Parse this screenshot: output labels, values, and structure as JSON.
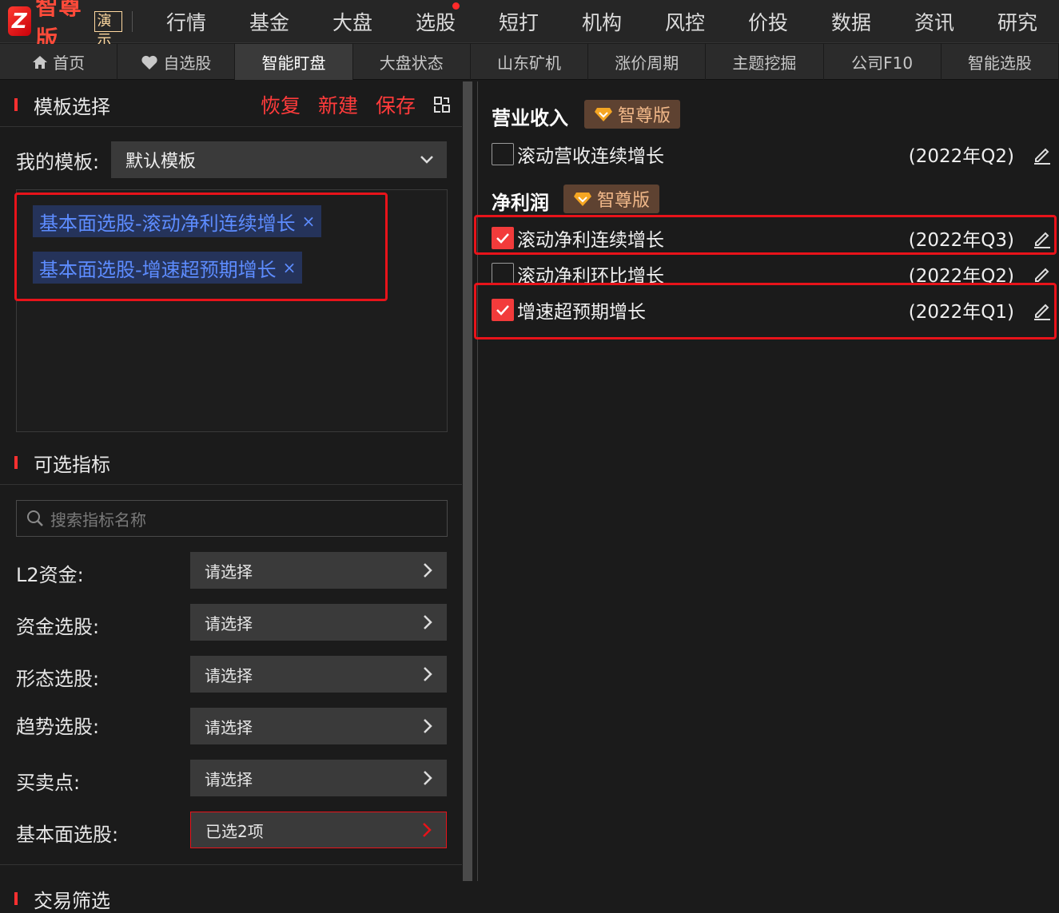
{
  "topbar": {
    "logo_mark": "Z",
    "logo_text": "智尊版",
    "logo_badge": "演示",
    "menu": [
      "行情",
      "基金",
      "大盘",
      "选股",
      "短打",
      "机构",
      "风控",
      "价投",
      "数据",
      "资讯",
      "研究"
    ]
  },
  "navbar": {
    "tabs": [
      {
        "label": "首页",
        "icon": "home-icon"
      },
      {
        "label": "自选股",
        "icon": "heart-icon"
      },
      {
        "label": "智能盯盘"
      },
      {
        "label": "大盘状态"
      },
      {
        "label": "山东矿机"
      },
      {
        "label": "涨价周期"
      },
      {
        "label": "主题挖掘"
      },
      {
        "label": "公司F10"
      },
      {
        "label": "智能选股"
      }
    ],
    "active_index": 2
  },
  "template_section": {
    "title": "模板选择",
    "actions": {
      "restore": "恢复",
      "new": "新建",
      "save": "保存"
    },
    "my_template_label": "我的模板:",
    "my_template_value": "默认模板",
    "tags": [
      "基本面选股-滚动净利连续增长",
      "基本面选股-增速超预期增长"
    ],
    "tag_close": "×"
  },
  "indicator_section": {
    "title": "可选指标",
    "search_placeholder": "搜索指标名称",
    "rows": [
      {
        "label": "L2资金:",
        "value": "请选择"
      },
      {
        "label": "资金选股:",
        "value": "请选择"
      },
      {
        "label": "形态选股:",
        "value": "请选择"
      },
      {
        "label": "趋势选股:",
        "value": "请选择"
      },
      {
        "label": "买卖点:",
        "value": "请选择"
      },
      {
        "label": "基本面选股:",
        "value": "已选2项"
      }
    ]
  },
  "next_section_title": "交易筛选",
  "right_panel": {
    "vip_label": "智尊版",
    "groups": [
      {
        "title": "营业收入",
        "items": [
          {
            "label": "滚动营收连续增长",
            "period": "(2022年Q2)",
            "checked": false
          }
        ]
      },
      {
        "title": "净利润",
        "items": [
          {
            "label": "滚动净利连续增长",
            "period": "(2022年Q3)",
            "checked": true
          },
          {
            "label": "滚动净利环比增长",
            "period": "(2022年Q2)",
            "checked": false
          },
          {
            "label": "增速超预期增长",
            "period": "(2022年Q1)",
            "checked": true
          }
        ]
      }
    ]
  },
  "colors": {
    "accent_red": "#ff3b3b",
    "highlight_box": "#e8131a",
    "tag_bg": "#25335a",
    "tag_text": "#5d8cff",
    "vip_bg": "#5e4231",
    "vip_text": "#f1b889"
  }
}
